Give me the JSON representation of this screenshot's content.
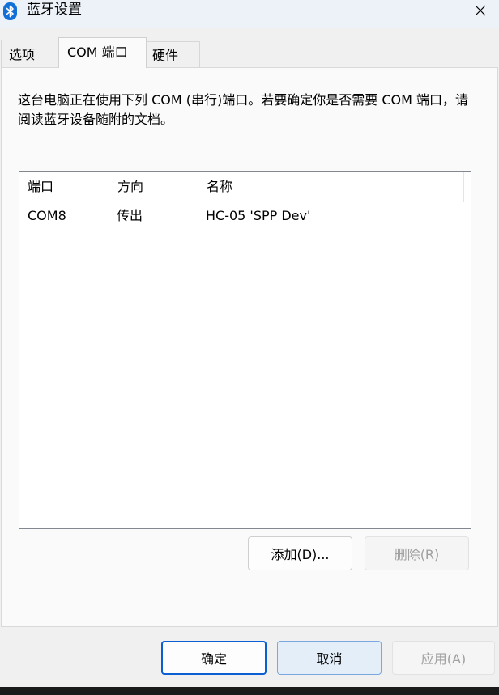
{
  "window": {
    "title": "蓝牙设置",
    "icon": "bluetooth-icon",
    "close_icon": "close-icon"
  },
  "tabs": [
    {
      "label": "选项",
      "selected": false
    },
    {
      "label": "COM 端口",
      "selected": true
    },
    {
      "label": "硬件",
      "selected": false
    }
  ],
  "description": "这台电脑正在使用下列 COM (串行)端口。若要确定你是否需要 COM 端口，请阅读蓝牙设备随附的文档。",
  "port_list": {
    "columns": [
      "端口",
      "方向",
      "名称"
    ],
    "rows": [
      {
        "port": "COM8",
        "direction": "传出",
        "name": "HC-05 'SPP Dev'"
      }
    ]
  },
  "list_buttons": {
    "add": "添加(D)...",
    "remove": "删除(R)"
  },
  "dialog_buttons": {
    "ok": "确定",
    "cancel": "取消",
    "apply": "应用(A)"
  },
  "colors": {
    "accent": "#0c5ed3",
    "bluetooth_icon": "#1270d6"
  }
}
